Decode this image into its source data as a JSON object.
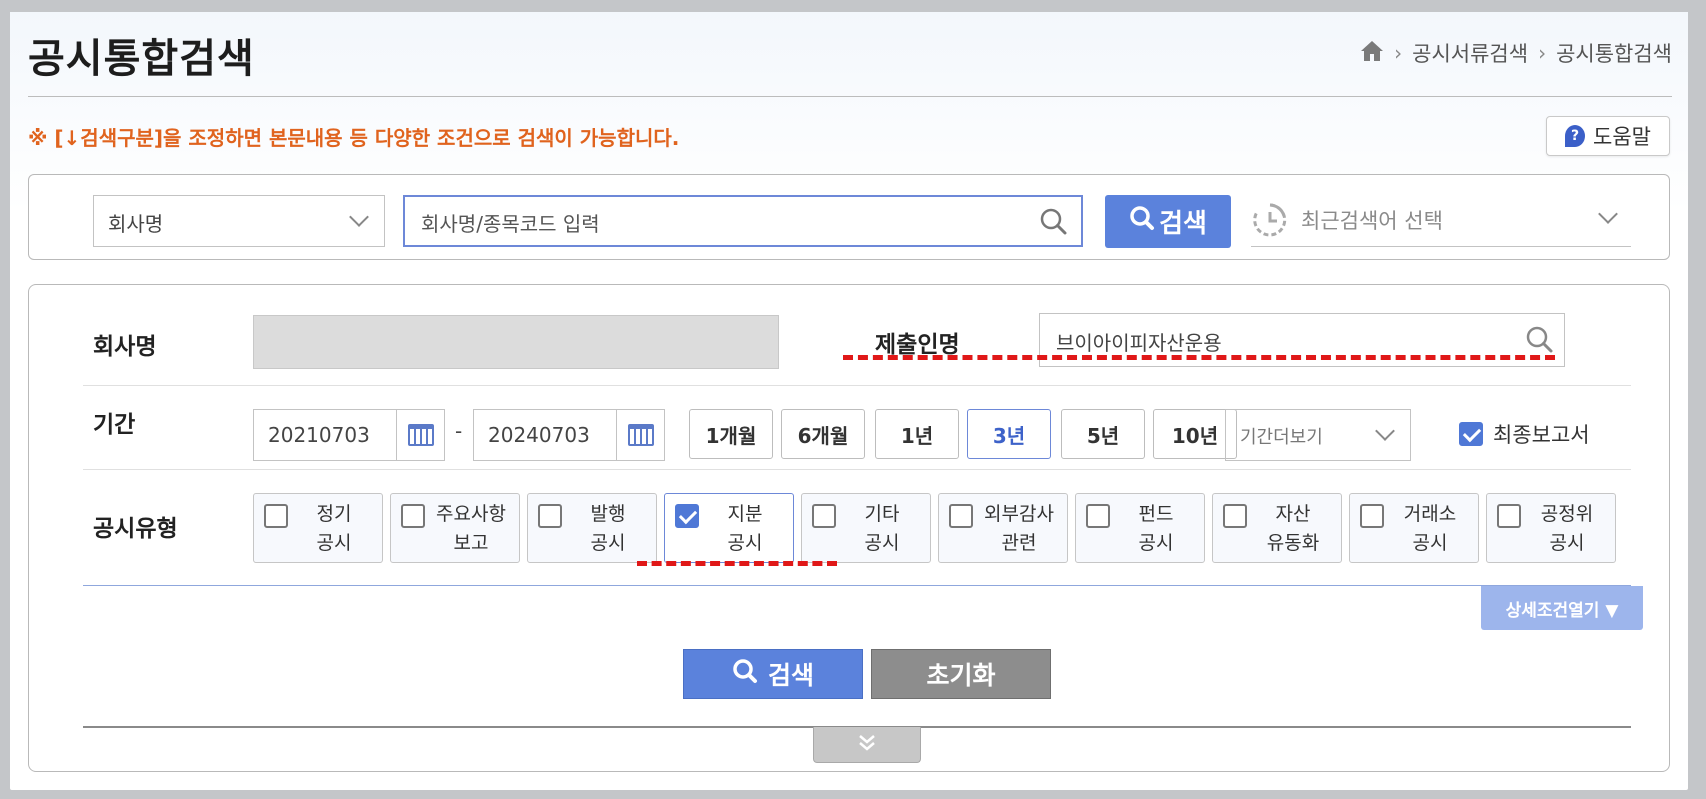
{
  "header": {
    "title": "공시통합검색",
    "breadcrumb": [
      "공시서류검색",
      "공시통합검색"
    ],
    "icons": {
      "home": "home-icon",
      "separator": "chevron-right-icon"
    }
  },
  "notice": "※ [↓검색구분]을 조정하면 본문내용 등 다양한 조건으로 검색이 가능합니다.",
  "help": {
    "label": "도움말",
    "icon": "question-icon"
  },
  "quick_search": {
    "category_selected": "회사명",
    "input_placeholder": "회사명/종목코드 입력",
    "search_label": "검색",
    "recent_placeholder": "최근검색어 선택"
  },
  "filters": {
    "company": {
      "label": "회사명",
      "value": ""
    },
    "submitter": {
      "label": "제출인명",
      "value": "브이아이피자산운용"
    },
    "period": {
      "label": "기간",
      "start": "20210703",
      "separator": "-",
      "end": "20240703",
      "buttons": [
        {
          "label": "1개월",
          "active": false
        },
        {
          "label": "6개월",
          "active": false
        },
        {
          "label": "1년",
          "active": false
        },
        {
          "label": "3년",
          "active": true
        },
        {
          "label": "5년",
          "active": false
        },
        {
          "label": "10년",
          "active": false
        }
      ],
      "more_label": "기간더보기",
      "final_report": {
        "label": "최종보고서",
        "checked": true
      }
    },
    "types": {
      "label": "공시유형",
      "items": [
        {
          "line1": "정기",
          "line2": "공시",
          "checked": false
        },
        {
          "line1": "주요사항",
          "line2": "보고",
          "checked": false
        },
        {
          "line1": "발행",
          "line2": "공시",
          "checked": false
        },
        {
          "line1": "지분",
          "line2": "공시",
          "checked": true
        },
        {
          "line1": "기타",
          "line2": "공시",
          "checked": false
        },
        {
          "line1": "외부감사",
          "line2": "관련",
          "checked": false
        },
        {
          "line1": "펀드",
          "line2": "공시",
          "checked": false
        },
        {
          "line1": "자산",
          "line2": "유동화",
          "checked": false
        },
        {
          "line1": "거래소",
          "line2": "공시",
          "checked": false
        },
        {
          "line1": "공정위",
          "line2": "공시",
          "checked": false
        }
      ]
    }
  },
  "actions": {
    "detail_toggle": "상세조건열기 ▼",
    "search": "검색",
    "reset": "초기화"
  },
  "colors": {
    "accent": "#5b82dc",
    "notice": "#e0631e",
    "annotation": "#e01818"
  }
}
